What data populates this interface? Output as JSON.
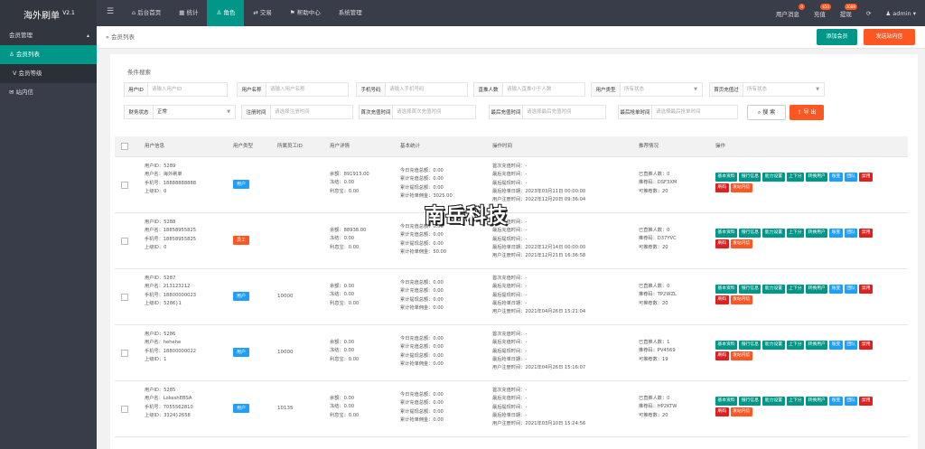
{
  "app": {
    "name": "海外刷单",
    "version": "V2.1"
  },
  "topnav": [
    {
      "label": "后台首页",
      "icon": "home-icon"
    },
    {
      "label": "统计",
      "icon": "stats-icon"
    },
    {
      "label": "角色",
      "icon": "user-icon"
    },
    {
      "label": "交易",
      "icon": "trade-icon"
    },
    {
      "label": "帮助中心",
      "icon": "flag-icon"
    },
    {
      "label": "系统管理",
      "icon": ""
    }
  ],
  "topright": {
    "user_msg": "用户消息",
    "user_msg_count": "0",
    "recharge": "充值",
    "recharge_count": "450",
    "withdraw": "提现",
    "withdraw_count": "2089",
    "refresh_icon": "refresh-icon",
    "admin": "admin"
  },
  "sidebar": {
    "group": "会员管理",
    "items": [
      {
        "label": "会员列表",
        "icon": "user-icon"
      },
      {
        "label": "会员等级",
        "icon": "vip-icon"
      },
      {
        "label": "站内信",
        "icon": "message-icon"
      }
    ]
  },
  "breadcrumb": "会员列表",
  "buttons": {
    "add_member": "添加会员",
    "send_message": "发送站内信",
    "search": "搜 索",
    "export": "导 出"
  },
  "search": {
    "title": "条件搜索",
    "uid_label": "用户ID",
    "uid_ph": "请输入用户ID",
    "uname_label": "用户名称",
    "uname_ph": "请输入用户名称",
    "phone_label": "手机号码",
    "phone_ph": "请输入手机号码",
    "direct_label": "直推人数",
    "direct_ph": "请输入直推小于人数",
    "utype_label": "用户类型",
    "utype_ph": "所有状态",
    "first_label": "首页充值过",
    "first_ph": "所有状态",
    "fin_label": "财务状态",
    "fin_value": "正常",
    "reg_label": "注册时间",
    "reg_ph": "请选择注册时间",
    "firstrc_label": "首次充值时间",
    "firstrc_ph": "请选择首次充值时间",
    "lastrc_label": "最后充值时间",
    "lastrc_ph": "请选择最后充值时间",
    "lastgrab_label": "最后抢单时间",
    "lastgrab_ph": "请选择最后抢单时间"
  },
  "table": {
    "headers": [
      "用户信息",
      "用户类型",
      "所属员工ID",
      "用户详情",
      "基本统计",
      "操作时间",
      "推荐情况",
      "操作"
    ],
    "actions": {
      "basic": "基本资料",
      "bank": "银行信息",
      "ability": "能力设置",
      "updown": "上下分",
      "fake": "转换用户",
      "change": "账变",
      "team": "团队",
      "disable": "禁用",
      "lock": "刷码",
      "msg": "发站内信"
    },
    "rows": [
      {
        "uid": "用户ID：5289",
        "uname": "用户名：海外刷单",
        "phone": "手机号：18888888888",
        "parent": "上级ID：0",
        "type": "用户",
        "type_color": "blue",
        "staff": "",
        "balance": "余额：891913.00",
        "frozen": "冻结：0.00",
        "interest": "利息宝：0.00",
        "stat1": "今日充值总额：0.00",
        "stat2": "累计充值总额：0.00",
        "stat3": "累计提现总额：0.00",
        "stat4": "累计抢单佣金：3025.00",
        "t1": "首次充值时间：-",
        "t2": "最后充值时间：-",
        "t3": "最后提现时间：-",
        "t4": "最后抢单日期：2023年03月11日 00:00:00",
        "t5": "用户注册时间：2022年12月20日 09:36:04",
        "ref1": "已直推人数：0",
        "ref2": "推荐码：DSF3XM",
        "ref3": "可推荐数：20"
      },
      {
        "uid": "用户ID：5288",
        "uname": "用户名：18858955825",
        "phone": "手机号：18858955825",
        "parent": "上级ID：0",
        "type": "员工",
        "type_color": "orange",
        "staff": "",
        "balance": "余额：88938.00",
        "frozen": "冻结：0.00",
        "interest": "利息宝：0.00",
        "stat1": "今日充值总额：0.00",
        "stat2": "累计充值总额：0.00",
        "stat3": "累计提现总额：0.00",
        "stat4": "累计抢单佣金：50.00",
        "t1": "首次充值时间：-",
        "t2": "最后充值时间：-",
        "t3": "最后提现时间：-",
        "t4": "最后抢单日期：2022年12月14日 00:00:00",
        "t5": "用户注册时间：2021年12月21日 16:36:58",
        "ref1": "已直推人数：0",
        "ref2": "推荐码：D37YVC",
        "ref3": "可推荐数：20"
      },
      {
        "uid": "用户ID：5287",
        "uname": "用户名：213123212",
        "phone": "手机号：18800000023",
        "parent": "上级ID：5286}1",
        "type": "用户",
        "type_color": "blue",
        "staff": "10000",
        "balance": "余额：0.00",
        "frozen": "冻结：0.00",
        "interest": "利息宝：0.00",
        "stat1": "今日充值总额：0.00",
        "stat2": "累计充值总额：0.00",
        "stat3": "累计提现总额：0.00",
        "stat4": "累计抢单佣金：0.00",
        "t1": "首次充值时间：-",
        "t2": "最后充值时间：-",
        "t3": "最后提现时间：-",
        "t4": "最后抢单日期：-",
        "t5": "用户注册时间：2021年04月26日 15:21:04",
        "ref1": "已直推人数：0",
        "ref2": "推荐码：TP2WZL",
        "ref3": "可推荐数：20"
      },
      {
        "uid": "用户ID：5286",
        "uname": "用户名：hehehe",
        "phone": "手机号：18800000022",
        "parent": "上级ID：1",
        "type": "用户",
        "type_color": "blue",
        "staff": "10000",
        "balance": "余额：0.00",
        "frozen": "冻结：0.00",
        "interest": "利息宝：0.00",
        "stat1": "今日充值总额：0.00",
        "stat2": "累计充值总额：0.00",
        "stat3": "累计提现总额：0.00",
        "stat4": "累计抢单佣金：0.00",
        "t1": "首次充值时间：-",
        "t2": "最后充值时间：-",
        "t3": "最后提现时间：-",
        "t4": "最后抢单日期：-",
        "t5": "用户注册时间：2021年04月26日 15:16:07",
        "ref1": "已直推人数：1",
        "ref2": "推荐码：PV4569",
        "ref3": "可推荐数：19"
      },
      {
        "uid": "用户ID：5285",
        "uname": "用户名：LokeshEBSA",
        "phone": "手机号：7055562810",
        "parent": "上级ID：3324}2658",
        "type": "用户",
        "type_color": "blue",
        "staff": "10135",
        "balance": "余额：0.00",
        "frozen": "冻结：0.00",
        "interest": "利息宝：0.00",
        "stat1": "今日充值总额：0.00",
        "stat2": "累计充值总额：0.00",
        "stat3": "累计提现总额：0.00",
        "stat4": "累计抢单佣金：0.00",
        "t1": "首次充值时间：-",
        "t2": "最后充值时间：-",
        "t3": "最后提现时间：-",
        "t4": "最后抢单日期：-",
        "t5": "用户注册时间：2021年03月10日 15:24:56",
        "ref1": "已直推人数：0",
        "ref2": "推荐码：HP2KTW",
        "ref3": "可推荐数：20"
      }
    ]
  },
  "watermark": "南岳科技",
  "colors": {
    "header": "#393d49",
    "accent": "#009688",
    "orange": "#ff5722",
    "blue": "#1e9fff",
    "red": "#e02020"
  }
}
